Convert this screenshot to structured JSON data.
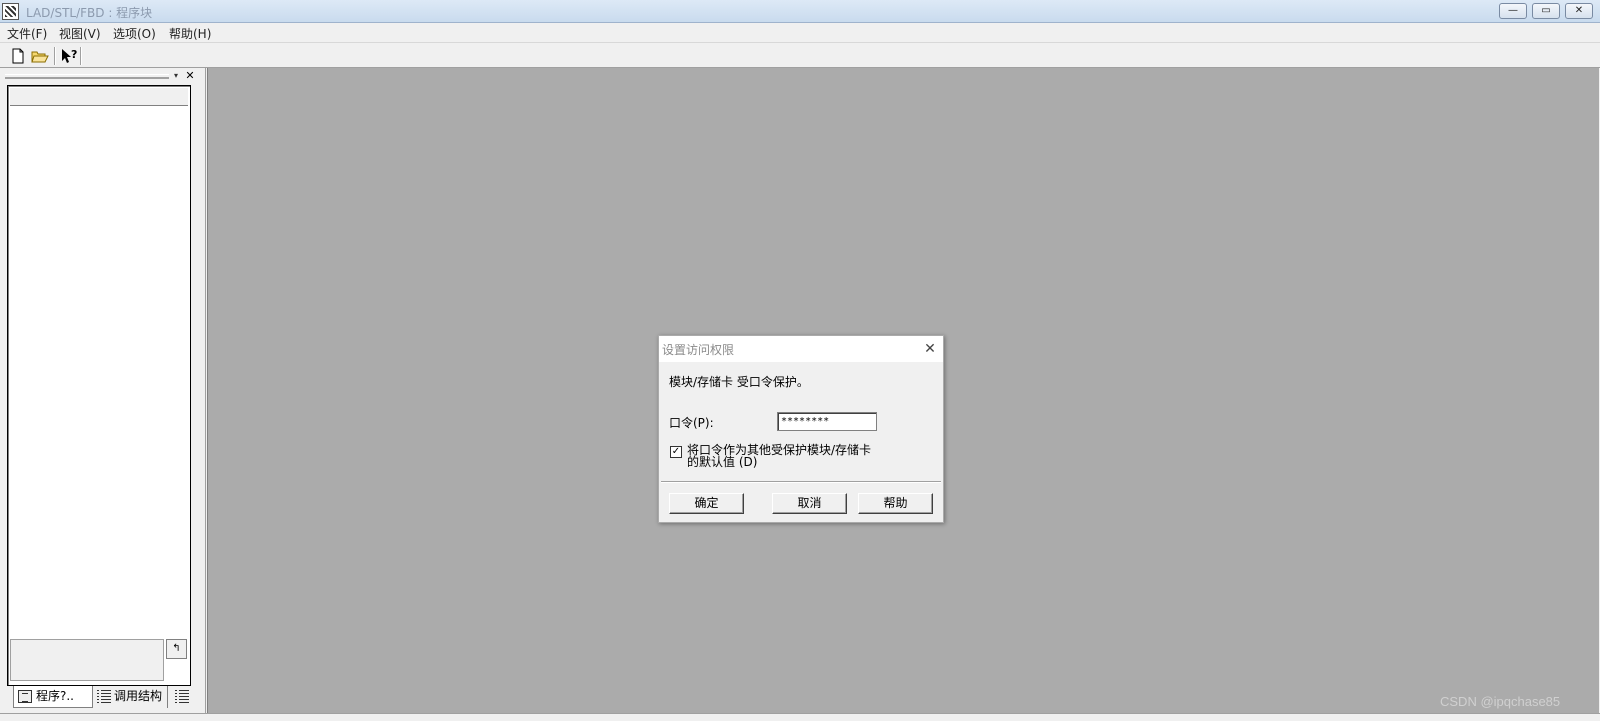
{
  "window": {
    "title": "LAD/STL/FBD : 程序块",
    "controls": {
      "minimize": "—",
      "restore": "▭",
      "close": "✕"
    }
  },
  "menubar": {
    "items": [
      {
        "label": "文件(F)"
      },
      {
        "label": "视图(V)"
      },
      {
        "label": "选项(O)"
      },
      {
        "label": "帮助(H)"
      }
    ]
  },
  "toolbar": {
    "buttons": [
      {
        "icon": "new-file-icon"
      },
      {
        "icon": "open-folder-icon"
      },
      {
        "icon": "context-help-icon"
      }
    ]
  },
  "left_panel": {
    "dropdown_glyph": "▾",
    "close_glyph": "✕",
    "info_button_glyph": "↰",
    "tabs": [
      {
        "label": "程序?..",
        "active": true
      },
      {
        "label": "调用结构",
        "active": false
      }
    ]
  },
  "dialog": {
    "title": "设置访问权限",
    "close_glyph": "✕",
    "message": "模块/存储卡  受口令保护。",
    "password_label": "口令(P):",
    "password_value": "********",
    "checkbox": {
      "checked": true,
      "glyph": "✓",
      "label": "将口令作为其他受保护模块/存储卡的默认值 (D)"
    },
    "buttons": {
      "ok": "确定",
      "cancel": "取消",
      "help": "帮助"
    }
  },
  "watermark": "CSDN @ipqchase85"
}
